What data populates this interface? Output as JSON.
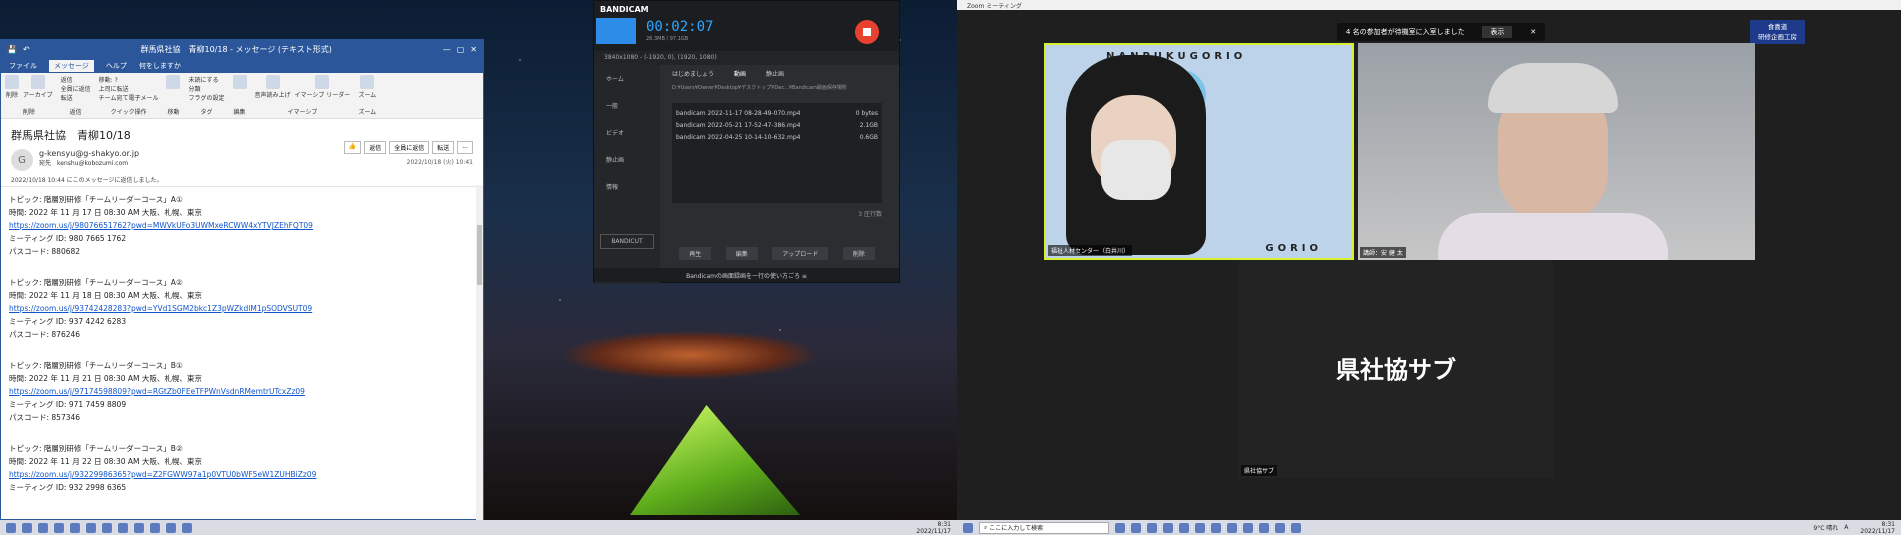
{
  "outlook": {
    "title": "群馬県社協　青柳10/18 - メッセージ (テキスト形式)",
    "tabs": [
      "ファイル",
      "メッセージ",
      "ヘルプ",
      "何をしますか"
    ],
    "ribbon": {
      "delete": "削除",
      "archive": "アーカイブ",
      "reply": "返信",
      "reply_all": "全員に返信",
      "forward": "転送",
      "move_to": "移動: ?",
      "to_manager": "上司に転送",
      "team_email": "チーム宛て電子メール",
      "quick_steps": "クイック操作",
      "unread": "未読にする",
      "categorize": "分類",
      "follow_up": "フラグの設定",
      "translate": "翻訳",
      "read_aloud": "音声読み上げ",
      "immersive": "イマーシブ リーダー",
      "zoom": "ズーム",
      "groups": [
        "削除",
        "返信",
        "移動",
        "タグ",
        "編集",
        "イマーシブ",
        "ズーム"
      ]
    },
    "subject": "群馬県社協　青柳10/18",
    "from": "g-kensyu@g-shakyo.or.jp",
    "to_label": "宛先",
    "to": "kenshu@kobozumi.com",
    "date": "2022/10/18 (火) 10:41",
    "avatar": "G",
    "info": "2022/10/18 10:44 にこのメッセージに返信しました。",
    "actions": [
      "返信",
      "全員に返信",
      "転送",
      "..."
    ],
    "meetings": [
      {
        "topic": "トピック: 階層別研修「チームリーダーコース」A①",
        "time": "時間: 2022 年 11 月 17 日 08:30 AM 大阪、札幌、東京",
        "url": "https://zoom.us/j/98076651762?pwd=MWVkUFo3UWMxeRCWW4xYTVJZEhFQT09",
        "id": "ミーティング ID: 980 7665 1762",
        "pass": "パスコード: 880682"
      },
      {
        "topic": "トピック: 階層別研修「チームリーダーコース」A②",
        "time": "時間: 2022 年 11 月 18 日 08:30 AM 大阪、札幌、東京",
        "url": "https://zoom.us/j/93742428283?pwd=YVd1SGM2bkc1Z3pWZkdlM1pSODVSUT09",
        "id": "ミーティング ID: 937 4242 6283",
        "pass": "パスコード: 876246"
      },
      {
        "topic": "トピック: 階層別研修「チームリーダーコース」B①",
        "time": "時間: 2022 年 11 月 21 日 08:30 AM 大阪、札幌、東京",
        "url": "https://zoom.us/j/97174598809?pwd=RGtZb0FEeTFPWnVsdnRMemtrUTcxZz09",
        "id": "ミーティング ID: 971 7459 8809",
        "pass": "パスコード: 857346"
      },
      {
        "topic": "トピック: 階層別研修「チームリーダーコース」B②",
        "time": "時間: 2022 年 11 月 22 日 08:30 AM 大阪、札幌、東京",
        "url": "https://zoom.us/j/93229986365?pwd=Z2FGWW97a1p0VTU0bWF5eW1ZUHBiZz09",
        "id": "ミーティング ID: 932 2998 6365",
        "pass": ""
      }
    ]
  },
  "bandicam": {
    "logo": "BANDICAM",
    "time": "00:02:07",
    "size": "26.3MB / 97.1GB",
    "resolution": "3840x1080 - (-1920, 0), (1920, 1080)",
    "sidebar": [
      "ホーム",
      "一般",
      "ビデオ",
      "静止画",
      "情報"
    ],
    "tabs": [
      "はじめましょう",
      "動画",
      "静止画"
    ],
    "path": "D:¥Users¥Owner¥Desktop¥デスクトップ¥Dec...¥Bandicam録画保存場所",
    "files": [
      {
        "name": "bandicam 2022-11-17 08-28-49-070.mp4",
        "size": "0 bytes"
      },
      {
        "name": "bandicam 2022-05-21 17-52-47-386.mp4",
        "size": "2.1GB"
      },
      {
        "name": "bandicam 2022-04-25 10-14-10-632.mp4",
        "size": "0.6GB"
      }
    ],
    "file_count": "3 圧行数",
    "buttons": [
      "再生",
      "編集",
      "アップロード",
      "削除"
    ],
    "bandicut": "BANDICUT",
    "footer": "Bandicamの画面録画をー行の使い方ごろ ≡"
  },
  "zoom": {
    "window_title": "Zoom ミーティング",
    "waiting_banner": "4 名の参加者が待機室に入室しました",
    "show_button": "表示",
    "org_tag": "食喜道\n研修企画工房",
    "participants": [
      {
        "name": "福祉人材センター（白井川）"
      },
      {
        "name": "講師：安 健 太"
      },
      {
        "name": "県社協サブ"
      }
    ],
    "big_name": "県社協サブ",
    "poster_text_top": "NANPUKUGORIO",
    "poster_text_bottom": "GORIO"
  },
  "taskbar": {
    "search_placeholder": "ここに入力して検索",
    "weather": "9°C 晴れ",
    "time_left": "8:31",
    "date_left": "2022/11/17",
    "time_right": "8:31",
    "date_right": "2022/11/17",
    "ime": "A"
  }
}
